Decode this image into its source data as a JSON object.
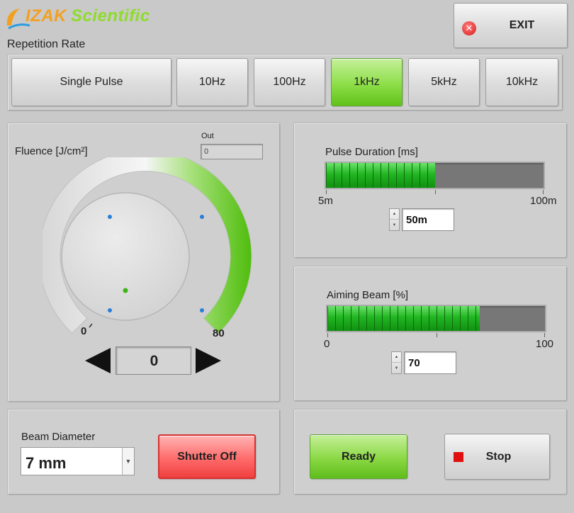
{
  "logo": {
    "brand": "IZAK",
    "word": "Scientific"
  },
  "exit": {
    "label": "EXIT",
    "icon": "close-icon",
    "icon_glyph": "✕"
  },
  "repetition_rate": {
    "label": "Repetition Rate",
    "options": [
      "Single Pulse",
      "10Hz",
      "100Hz",
      "1kHz",
      "5kHz",
      "10kHz"
    ],
    "selected": "1kHz"
  },
  "fluence": {
    "label": "Fluence [J/cm²]",
    "out_label": "Out",
    "out_value": "0",
    "min_label": "0",
    "max_label": "80",
    "value_display": "0",
    "value": 0,
    "min": 0,
    "max": 80
  },
  "pulse_duration": {
    "label": "Pulse Duration [ms]",
    "min_label": "5m",
    "max_label": "100m",
    "value_display": "50m",
    "fill_fraction": 0.5
  },
  "aiming_beam": {
    "label": "Aiming Beam [%]",
    "min_label": "0",
    "max_label": "100",
    "value_display": "70",
    "fill_fraction": 0.7
  },
  "beam_diameter": {
    "label": "Beam Diameter",
    "value": "7 mm"
  },
  "shutter": {
    "label": "Shutter Off"
  },
  "ready": {
    "label": "Ready"
  },
  "stop": {
    "label": "Stop",
    "icon": "stop-icon"
  },
  "colors": {
    "active_green": "#8dde48",
    "bar_green": "#22b522",
    "shutter_red": "#ff6b6b",
    "logo_orange": "#f2a020",
    "logo_green": "#8fdc2a"
  }
}
